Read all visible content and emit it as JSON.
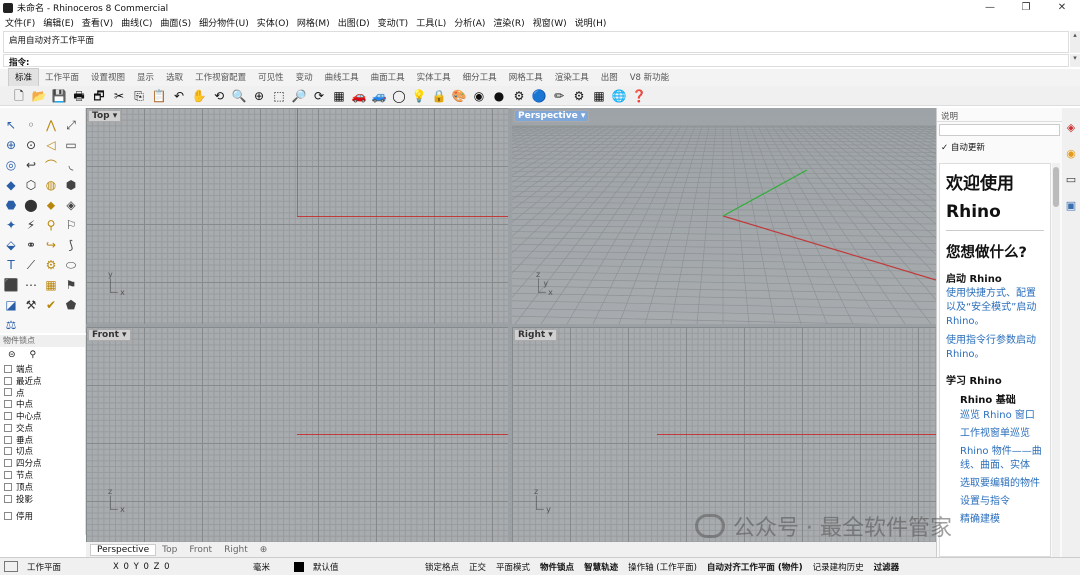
{
  "window": {
    "title": "未命名 - Rhinoceros 8 Commercial",
    "controls": [
      "—",
      "❐",
      "✕"
    ]
  },
  "menu": [
    "文件(F)",
    "编辑(E)",
    "查看(V)",
    "曲线(C)",
    "曲面(S)",
    "细分物件(U)",
    "实体(O)",
    "网格(M)",
    "出图(D)",
    "变动(T)",
    "工具(L)",
    "分析(A)",
    "渲染(R)",
    "视窗(W)",
    "说明(H)"
  ],
  "command": {
    "history": "启用自动对齐工作平面",
    "prompt": "指令:"
  },
  "tabs": [
    "标准",
    "工作平面",
    "设置视图",
    "显示",
    "选取",
    "工作视窗配置",
    "可见性",
    "变动",
    "曲线工具",
    "曲面工具",
    "实体工具",
    "细分工具",
    "网格工具",
    "渲染工具",
    "出图",
    "V8 新功能"
  ],
  "toolbar_icons": [
    "new-icon",
    "open-icon",
    "save-icon",
    "print-icon",
    "import-icon",
    "cut-icon",
    "copy-icon",
    "paste-icon",
    "undo-icon",
    "pan-icon",
    "rotate-view-icon",
    "zoom-icon",
    "zoom-extents-icon",
    "zoom-window-icon",
    "zoom-selected-icon",
    "undo-view-icon",
    "viewport-layout-icon",
    "car-icon",
    "car2-icon",
    "sphere-icon",
    "lightbulb-icon",
    "lock-icon",
    "material-icon",
    "color-wheel-icon",
    "render-sphere-icon",
    "settings-icon",
    "blue-sphere-icon",
    "pencil-icon",
    "gears-icon",
    "grid-icon",
    "globe-icon",
    "help-icon"
  ],
  "toolbar_glyphs": [
    "🗋",
    "📂",
    "💾",
    "🖶",
    "🗗",
    "✂",
    "⎘",
    "📋",
    "↶",
    "✋",
    "⟲",
    "🔍",
    "⊕",
    "⬚",
    "🔎",
    "⟳",
    "▦",
    "🚗",
    "🚙",
    "◯",
    "💡",
    "🔒",
    "🎨",
    "◉",
    "●",
    "⚙",
    "🔵",
    "✏",
    "⚙",
    "▦",
    "🌐",
    "❓"
  ],
  "left_tools": [
    "↖",
    "◦",
    "⋀",
    "⤢",
    "⊕",
    "⊙",
    "◁",
    "▭",
    "◎",
    "↩",
    "⌒",
    "◟",
    "◆",
    "⬡",
    "◍",
    "⬢",
    "⬣",
    "⬤",
    "⬥",
    "◈",
    "✦",
    "⚡",
    "⚲",
    "⚐",
    "⬙",
    "⚭",
    "↪",
    "⟆",
    "T",
    "⟋",
    "⚙",
    "⬭",
    "⬛",
    "⋯",
    "▦",
    "⚑",
    "◪",
    "⚒",
    "✔",
    "⬟",
    "⚖"
  ],
  "osnap": {
    "title": "物件锁点",
    "items": [
      "端点",
      "最近点",
      "点",
      "中点",
      "中心点",
      "交点",
      "垂点",
      "切点",
      "四分点",
      "节点",
      "顶点",
      "投影"
    ],
    "disable": "停用"
  },
  "viewports": [
    {
      "name": "Top",
      "active": false
    },
    {
      "name": "Perspective",
      "active": true
    },
    {
      "name": "Front",
      "active": false
    },
    {
      "name": "Right",
      "active": false
    }
  ],
  "viewport_tabs": [
    "Perspective",
    "Top",
    "Front",
    "Right",
    "⊕"
  ],
  "help_panel": {
    "title": "说明",
    "auto_update": "✓ 自动更新",
    "welcome": "欢迎使用 Rhino",
    "question": "您想做什么?",
    "start_heading": "启动 Rhino",
    "start_links": [
      "使用快捷方式、配置以及“安全模式”启动 Rhino。",
      "使用指令行参数启动 Rhino。"
    ],
    "learn_heading": "学习 Rhino",
    "basics_heading": "Rhino 基础",
    "basics_links": [
      "巡览 Rhino 窗口",
      "工作视窗单巡览",
      "Rhino 物件——曲线、曲面、实体",
      "选取要编辑的物件",
      "设置与指令",
      "精确建模"
    ]
  },
  "side_icons": [
    "layers-icon",
    "color-icon",
    "display-icon",
    "image-icon"
  ],
  "status": {
    "cplane": "工作平面",
    "coords": "X 0 Y 0 Z 0",
    "units": "毫米",
    "layer": "默认值",
    "toggles": [
      "锁定格点",
      "正交",
      "平面模式",
      "物件锁点",
      "智慧轨迹",
      "操作轴 (工作平面)",
      "自动对齐工作平面 (物件)",
      "记录建构历史",
      "过滤器"
    ],
    "bold": [
      "物件锁点",
      "智慧轨迹",
      "自动对齐工作平面 (物件)",
      "过滤器"
    ]
  },
  "watermark": "公众号 · 最全软件管家",
  "colors": {
    "axis_x": "#c03a3a",
    "axis_y": "#2fae3a",
    "viewport_bg": "#a9acae",
    "active_label": "#7ea6d8",
    "link": "#2a6ebb"
  }
}
